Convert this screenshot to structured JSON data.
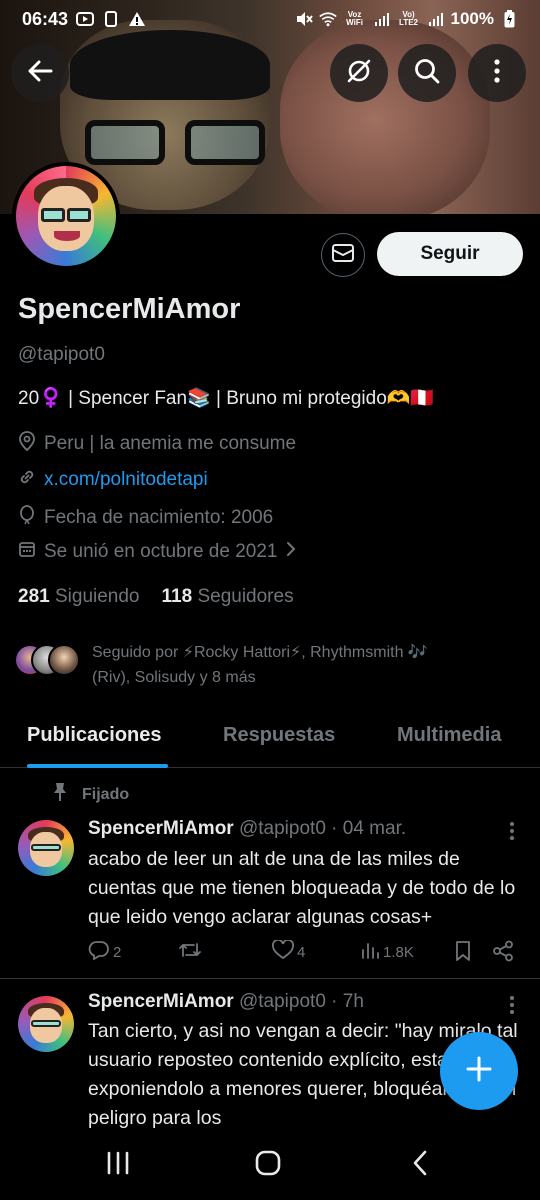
{
  "status_bar": {
    "time": "06:43",
    "network_label_1": "Voz WiFi",
    "network_label_2": "Vo) LTE2",
    "battery": "100%",
    "icons": [
      "youtube-icon",
      "phone-icon",
      "warning-icon",
      "mute-icon",
      "wifi-icon",
      "signal-icon",
      "battery-icon"
    ]
  },
  "header": {
    "icons": [
      "back-arrow-icon",
      "grok-icon",
      "search-icon",
      "more-vertical-icon"
    ]
  },
  "profile": {
    "display_name": "SpencerMiAmor",
    "handle": "@tapipot0",
    "bio": "20♀️ | Spencer Fan📚 | Bruno mi protegido🫶🇵🇪",
    "location": "Peru | la anemia me consume",
    "website": "x.com/polnitodetapi",
    "birth": "Fecha de nacimiento: 2006",
    "joined": "Se unió en octubre de 2021",
    "following_count": "281",
    "following_label": "Siguiendo",
    "followers_count": "118",
    "followers_label": "Seguidores",
    "follow_button": "Seguir",
    "followed_by_line1": "Seguido por ⚡Rocky Hattori⚡, Rhythmsmith 🎶",
    "followed_by_line2": "(Riv), Solisudy y 8 más"
  },
  "tabs": [
    {
      "label": "Publicaciones",
      "active": true
    },
    {
      "label": "Respuestas",
      "active": false
    },
    {
      "label": "Multimedia",
      "active": false
    }
  ],
  "pinned_label": "Fijado",
  "posts": [
    {
      "name": "SpencerMiAmor",
      "meta": "@tapipot0 · 04 mar.",
      "text": "acabo de leer un alt de una de las miles de cuentas que me tienen bloqueada y de todo de lo que leido vengo aclarar algunas cosas+",
      "replies": "2",
      "reposts": "",
      "likes": "4",
      "views": "1.8K"
    },
    {
      "name": "SpencerMiAmor",
      "meta": "@tapipot0 · 7h",
      "text": "Tan cierto, y asi no vengan a decir: \"hay miralo tal usuario reposteo contenido explícito, esta exponiendolo a menores querer, bloquéalo, es un peligro para los"
    }
  ],
  "accent_color": "#1d9bf0"
}
